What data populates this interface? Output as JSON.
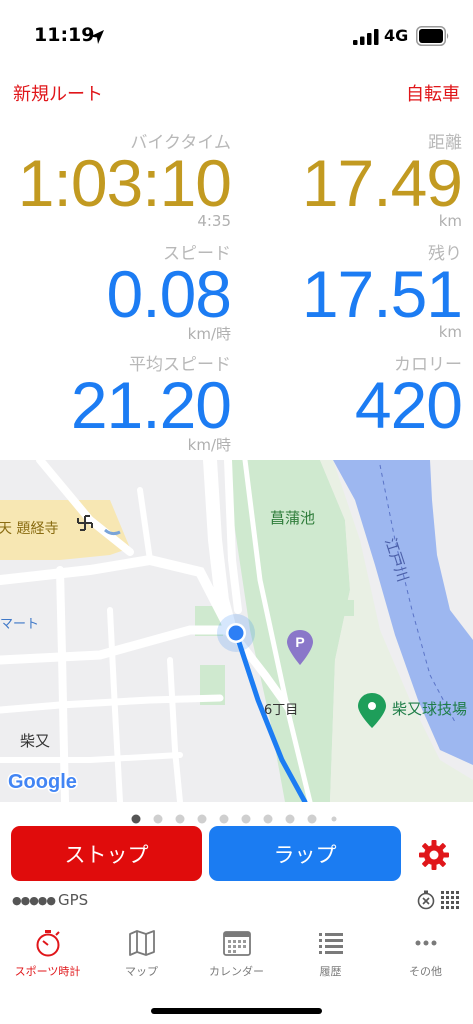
{
  "status_bar": {
    "time": "11:19",
    "network": "4G"
  },
  "header": {
    "left_link": "新規ルート",
    "right_link": "自転車"
  },
  "metrics": {
    "bike_time": {
      "label": "バイクタイム",
      "value": "1:03:10",
      "sub": "4:35"
    },
    "distance": {
      "label": "距離",
      "value": "17.49",
      "unit": "km"
    },
    "speed": {
      "label": "スピード",
      "value": "0.08",
      "unit": "km/時"
    },
    "remaining": {
      "label": "残り",
      "value": "17.51",
      "unit": "km"
    },
    "avg_speed": {
      "label": "平均スピード",
      "value": "21.20",
      "unit": "km/時"
    },
    "calories": {
      "label": "カロリー",
      "value": "420"
    }
  },
  "map": {
    "labels": {
      "temple": "天 題経寺",
      "pond": "菖蒲池",
      "river": "江戸川",
      "mart": "マート",
      "shibamata": "柴又",
      "block": "6丁目",
      "ballpark": "柴又球技場",
      "google": "Google"
    },
    "page_count": 10,
    "active_page": 1
  },
  "controls": {
    "stop_label": "ストップ",
    "lap_label": "ラップ",
    "gps_label": "GPS"
  },
  "tabs": [
    {
      "label": "スポーツ時計",
      "icon": "stopwatch-icon",
      "active": true
    },
    {
      "label": "マップ",
      "icon": "map-icon",
      "active": false
    },
    {
      "label": "カレンダー",
      "icon": "calendar-icon",
      "active": false
    },
    {
      "label": "履歴",
      "icon": "list-icon",
      "active": false
    },
    {
      "label": "その他",
      "icon": "more-icon",
      "active": false
    }
  ],
  "colors": {
    "accent_red": "#e0161a",
    "gold": "#c29a21",
    "blue": "#1c7cf3",
    "stop_button": "#e00c0c",
    "lap_button": "#1b7cf2"
  }
}
